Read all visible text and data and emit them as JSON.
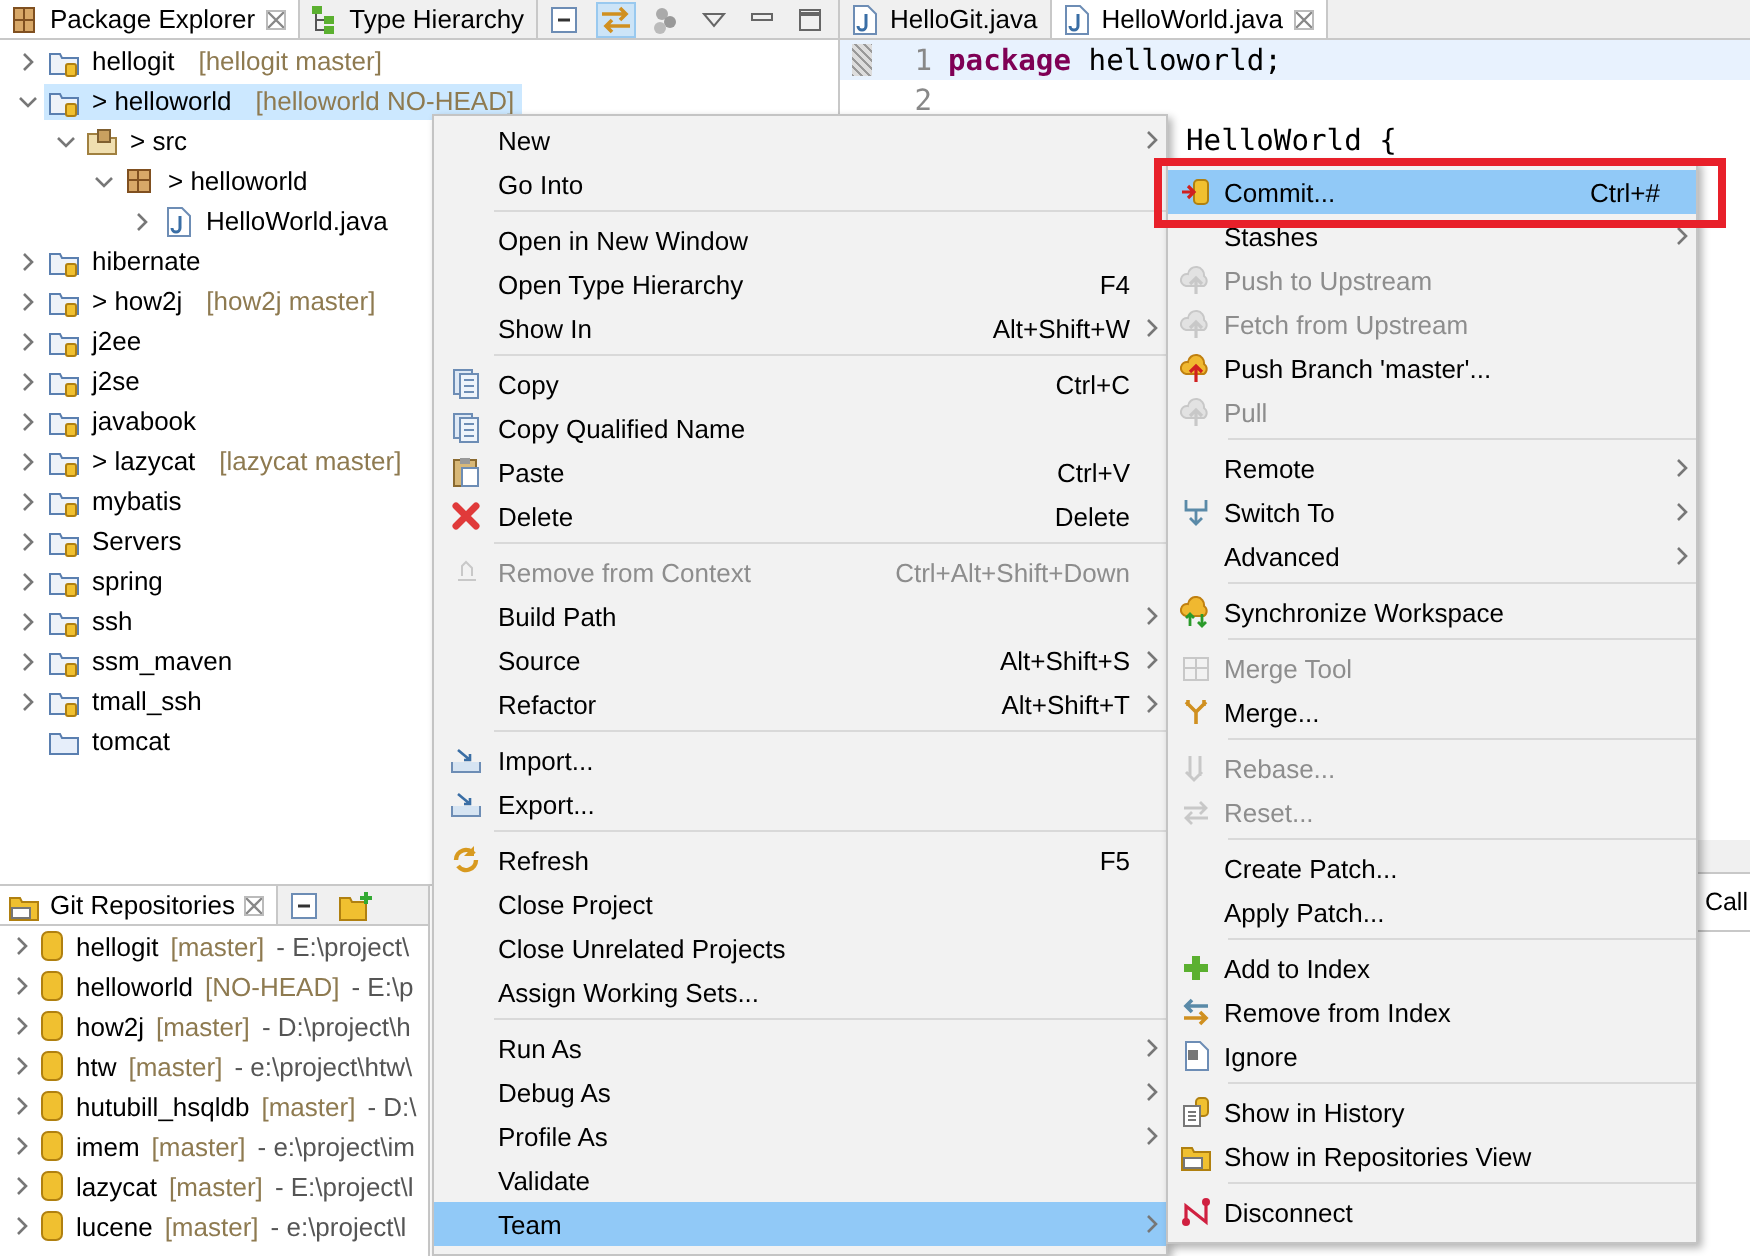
{
  "package_explorer": {
    "tabs": [
      {
        "label": "Package Explorer",
        "selected": true,
        "closable": true
      },
      {
        "label": "Type Hierarchy",
        "selected": false,
        "closable": false
      }
    ],
    "tree": [
      {
        "kind": "project",
        "label": "hellogit",
        "branch": "[hellogit master]",
        "expanded": false,
        "selected": false
      },
      {
        "kind": "project",
        "label": "> helloworld",
        "branch": "[helloworld NO-HEAD]",
        "expanded": true,
        "selected": true,
        "children": [
          {
            "kind": "source-folder",
            "label": "> src",
            "expanded": true,
            "selected": false,
            "children": [
              {
                "kind": "package",
                "label": "> helloworld",
                "expanded": true,
                "selected": false,
                "children": [
                  {
                    "kind": "java-file",
                    "label": "HelloWorld.java",
                    "expanded": false,
                    "selected": false
                  }
                ]
              }
            ]
          }
        ]
      },
      {
        "kind": "project",
        "label": "hibernate",
        "expanded": false,
        "selected": false
      },
      {
        "kind": "project",
        "label": "> how2j",
        "branch": "[how2j master]",
        "expanded": false,
        "selected": false
      },
      {
        "kind": "project",
        "label": "j2ee",
        "expanded": false,
        "selected": false
      },
      {
        "kind": "project",
        "label": "j2se",
        "expanded": false,
        "selected": false
      },
      {
        "kind": "project",
        "label": "javabook",
        "expanded": false,
        "selected": false
      },
      {
        "kind": "project",
        "label": "> lazycat",
        "branch": "[lazycat master]",
        "expanded": false,
        "selected": false
      },
      {
        "kind": "project",
        "label": "mybatis",
        "expanded": false,
        "selected": false
      },
      {
        "kind": "project",
        "label": "Servers",
        "expanded": false,
        "selected": false
      },
      {
        "kind": "project",
        "label": "spring",
        "expanded": false,
        "selected": false
      },
      {
        "kind": "project",
        "label": "ssh",
        "expanded": false,
        "selected": false
      },
      {
        "kind": "project",
        "label": "ssm_maven",
        "expanded": false,
        "selected": false
      },
      {
        "kind": "project",
        "label": "tmall_ssh",
        "expanded": false,
        "selected": false
      },
      {
        "kind": "folder",
        "label": "tomcat",
        "leaf": true,
        "expanded": false,
        "selected": false
      }
    ]
  },
  "editor": {
    "tabs": [
      {
        "label": "HelloGit.java",
        "selected": false,
        "closable": false
      },
      {
        "label": "HelloWorld.java",
        "selected": true,
        "closable": true
      }
    ],
    "lines": [
      {
        "kind": "code",
        "number": "1",
        "keyword": "package",
        "text": " helloworld;",
        "current": true,
        "marker": true
      },
      {
        "kind": "code",
        "number": "2",
        "current": false
      },
      {
        "kind": "partial",
        "text": "HelloWorld {",
        "current": false
      }
    ]
  },
  "git_repositories": {
    "tab": {
      "label": "Git Repositories",
      "selected": true,
      "closable": true
    },
    "repos": [
      {
        "name": "hellogit",
        "branch": "[master]",
        "path": "- E:\\project\\"
      },
      {
        "name": "helloworld",
        "branch": "[NO-HEAD]",
        "path": "- E:\\p"
      },
      {
        "name": "how2j",
        "branch": "[master]",
        "path": "- D:\\project\\h"
      },
      {
        "name": "htw",
        "branch": "[master]",
        "path": "- e:\\project\\htw\\"
      },
      {
        "name": "hutubill_hsqldb",
        "branch": "[master]",
        "path": "- D:\\"
      },
      {
        "name": "imem",
        "branch": "[master]",
        "path": "- e:\\project\\im"
      },
      {
        "name": "lazycat",
        "branch": "[master]",
        "path": "- E:\\project\\l"
      },
      {
        "name": "lucene",
        "branch": "[master]",
        "path": "- e:\\project\\l"
      }
    ]
  },
  "bottom_panel": {
    "tabs": [
      {
        "label": "Call",
        "selected": false
      }
    ]
  },
  "context_menu": {
    "items": [
      {
        "kind": "item",
        "label": "New",
        "submenu": true,
        "selected": false,
        "disabled": false
      },
      {
        "kind": "item",
        "label": "Go Into",
        "selected": false,
        "disabled": false
      },
      {
        "kind": "separator"
      },
      {
        "kind": "item",
        "label": "Open in New Window",
        "selected": false,
        "disabled": false
      },
      {
        "kind": "item",
        "label": "Open Type Hierarchy",
        "shortcut": "F4",
        "selected": false,
        "disabled": false
      },
      {
        "kind": "item",
        "label": "Show In",
        "shortcut": "Alt+Shift+W",
        "submenu": true,
        "selected": false,
        "disabled": false
      },
      {
        "kind": "separator"
      },
      {
        "kind": "item",
        "label": "Copy",
        "shortcut": "Ctrl+C",
        "selected": false,
        "disabled": false
      },
      {
        "kind": "item",
        "label": "Copy Qualified Name",
        "selected": false,
        "disabled": false
      },
      {
        "kind": "item",
        "label": "Paste",
        "shortcut": "Ctrl+V",
        "selected": false,
        "disabled": false
      },
      {
        "kind": "item",
        "label": "Delete",
        "shortcut": "Delete",
        "selected": false,
        "disabled": false
      },
      {
        "kind": "separator"
      },
      {
        "kind": "item",
        "label": "Remove from Context",
        "shortcut": "Ctrl+Alt+Shift+Down",
        "selected": false,
        "disabled": true
      },
      {
        "kind": "item",
        "label": "Build Path",
        "submenu": true,
        "selected": false,
        "disabled": false
      },
      {
        "kind": "item",
        "label": "Source",
        "shortcut": "Alt+Shift+S",
        "submenu": true,
        "selected": false,
        "disabled": false
      },
      {
        "kind": "item",
        "label": "Refactor",
        "shortcut": "Alt+Shift+T",
        "submenu": true,
        "selected": false,
        "disabled": false
      },
      {
        "kind": "separator"
      },
      {
        "kind": "item",
        "label": "Import...",
        "selected": false,
        "disabled": false
      },
      {
        "kind": "item",
        "label": "Export...",
        "selected": false,
        "disabled": false
      },
      {
        "kind": "separator"
      },
      {
        "kind": "item",
        "label": "Refresh",
        "shortcut": "F5",
        "selected": false,
        "disabled": false
      },
      {
        "kind": "item",
        "label": "Close Project",
        "selected": false,
        "disabled": false
      },
      {
        "kind": "item",
        "label": "Close Unrelated Projects",
        "selected": false,
        "disabled": false
      },
      {
        "kind": "item",
        "label": "Assign Working Sets...",
        "selected": false,
        "disabled": false
      },
      {
        "kind": "separator"
      },
      {
        "kind": "item",
        "label": "Run As",
        "submenu": true,
        "selected": false,
        "disabled": false
      },
      {
        "kind": "item",
        "label": "Debug As",
        "submenu": true,
        "selected": false,
        "disabled": false
      },
      {
        "kind": "item",
        "label": "Profile As",
        "submenu": true,
        "selected": false,
        "disabled": false
      },
      {
        "kind": "item",
        "label": "Validate",
        "selected": false,
        "disabled": false
      },
      {
        "kind": "item",
        "label": "Team",
        "submenu": true,
        "selected": true,
        "disabled": false
      }
    ]
  },
  "team_menu": {
    "items": [
      {
        "kind": "item",
        "label": "Commit...",
        "shortcut": "Ctrl+#",
        "selected": true,
        "disabled": false,
        "callout": true
      },
      {
        "kind": "item",
        "label": "Stashes",
        "submenu": true,
        "selected": false,
        "disabled": false
      },
      {
        "kind": "item",
        "label": "Push to Upstream",
        "selected": false,
        "disabled": true
      },
      {
        "kind": "item",
        "label": "Fetch from Upstream",
        "selected": false,
        "disabled": true
      },
      {
        "kind": "item",
        "label": "Push Branch 'master'...",
        "selected": false,
        "disabled": false
      },
      {
        "kind": "item",
        "label": "Pull",
        "selected": false,
        "disabled": true
      },
      {
        "kind": "separator"
      },
      {
        "kind": "item",
        "label": "Remote",
        "submenu": true,
        "selected": false,
        "disabled": false
      },
      {
        "kind": "item",
        "label": "Switch To",
        "submenu": true,
        "selected": false,
        "disabled": false
      },
      {
        "kind": "item",
        "label": "Advanced",
        "submenu": true,
        "selected": false,
        "disabled": false
      },
      {
        "kind": "separator"
      },
      {
        "kind": "item",
        "label": "Synchronize Workspace",
        "selected": false,
        "disabled": false
      },
      {
        "kind": "separator"
      },
      {
        "kind": "item",
        "label": "Merge Tool",
        "selected": false,
        "disabled": true
      },
      {
        "kind": "item",
        "label": "Merge...",
        "selected": false,
        "disabled": false
      },
      {
        "kind": "separator"
      },
      {
        "kind": "item",
        "label": "Rebase...",
        "selected": false,
        "disabled": true
      },
      {
        "kind": "item",
        "label": "Reset...",
        "selected": false,
        "disabled": true
      },
      {
        "kind": "separator"
      },
      {
        "kind": "item",
        "label": "Create Patch...",
        "selected": false,
        "disabled": false
      },
      {
        "kind": "item",
        "label": "Apply Patch...",
        "selected": false,
        "disabled": false
      },
      {
        "kind": "separator"
      },
      {
        "kind": "item",
        "label": "Add to Index",
        "selected": false,
        "disabled": false
      },
      {
        "kind": "item",
        "label": "Remove from Index",
        "selected": false,
        "disabled": false
      },
      {
        "kind": "item",
        "label": "Ignore",
        "selected": false,
        "disabled": false
      },
      {
        "kind": "separator"
      },
      {
        "kind": "item",
        "label": "Show in History",
        "selected": false,
        "disabled": false
      },
      {
        "kind": "item",
        "label": "Show in Repositories View",
        "selected": false,
        "disabled": false
      },
      {
        "kind": "separator"
      },
      {
        "kind": "item",
        "label": "Disconnect",
        "selected": false,
        "disabled": false
      }
    ]
  }
}
